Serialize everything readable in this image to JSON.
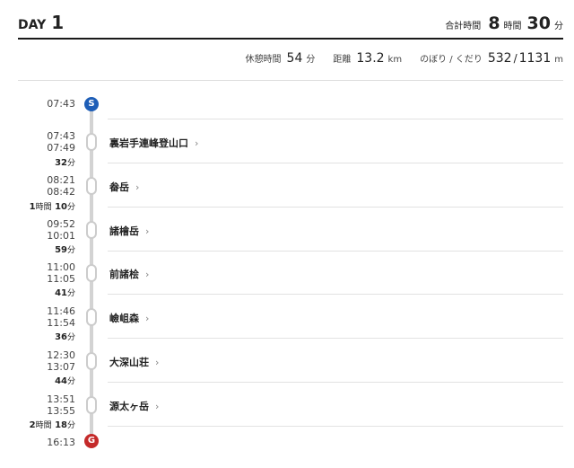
{
  "header": {
    "day_label": "DAY",
    "day_number": "1",
    "total_label": "合計時間",
    "total_hours": "8",
    "hours_unit": "時間",
    "total_minutes": "30",
    "minutes_unit": "分"
  },
  "stats": {
    "rest_label": "休憩時間",
    "rest_value": "54",
    "rest_unit": "分",
    "distance_label": "距離",
    "distance_value": "13.2",
    "distance_unit": "km",
    "climb_label": "のぼり / くだり",
    "climb_up": "532",
    "climb_sep": "/",
    "climb_down": "1131",
    "climb_unit": "m"
  },
  "markers": {
    "start": "S",
    "goal": "G"
  },
  "start_time": "07:43",
  "goal_time": "16:13",
  "segments": [
    {
      "duration_main": "32",
      "duration_unit": "分"
    },
    {
      "duration_h": "1",
      "duration_h_unit": "時間",
      "duration_main": "10",
      "duration_unit": "分"
    },
    {
      "duration_main": "59",
      "duration_unit": "分"
    },
    {
      "duration_main": "41",
      "duration_unit": "分"
    },
    {
      "duration_main": "36",
      "duration_unit": "分"
    },
    {
      "duration_main": "44",
      "duration_unit": "分"
    },
    {
      "duration_h": "2",
      "duration_h_unit": "時間",
      "duration_main": "18",
      "duration_unit": "分"
    }
  ],
  "spots": [
    {
      "name": "裏岩手連峰登山口",
      "arrive": "07:43",
      "depart": "07:49"
    },
    {
      "name": "畚岳",
      "arrive": "08:21",
      "depart": "08:42"
    },
    {
      "name": "諸檜岳",
      "arrive": "09:52",
      "depart": "10:01"
    },
    {
      "name": "前諸桧",
      "arrive": "11:00",
      "depart": "11:05"
    },
    {
      "name": "嶮岨森",
      "arrive": "11:46",
      "depart": "11:54"
    },
    {
      "name": "大深山荘",
      "arrive": "12:30",
      "depart": "13:07"
    },
    {
      "name": "源太ヶ岳",
      "arrive": "13:51",
      "depart": "13:55"
    }
  ],
  "chevron": "›"
}
